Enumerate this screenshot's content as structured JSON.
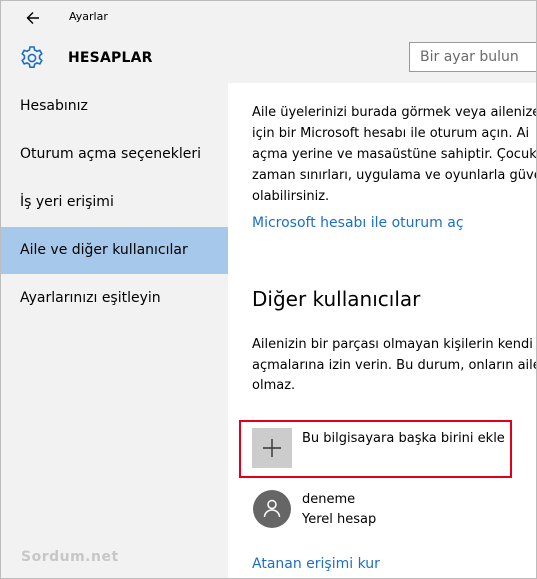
{
  "window": {
    "title": "Ayarlar",
    "back_icon": "arrow-left-icon"
  },
  "header": {
    "gear_icon": "gear-icon",
    "heading": "HESAPLAR",
    "search_placeholder": "Bir ayar bulun"
  },
  "sidebar": {
    "items": [
      {
        "label": "Hesabınız",
        "selected": false
      },
      {
        "label": "Oturum açma seçenekleri",
        "selected": false
      },
      {
        "label": "İş yeri erişimi",
        "selected": false
      },
      {
        "label": "Aile ve diğer kullanıcılar",
        "selected": true
      },
      {
        "label": "Ayarlarınızı eşitleyin",
        "selected": false
      }
    ],
    "watermark": "Sordum.net",
    "selected_color": "#a6c8ea"
  },
  "main": {
    "family_paragraph": [
      "Aile üyelerinizi burada görmek veya ailenize",
      "için bir Microsoft hesabı ile oturum açın. Ai",
      "açma yerine ve masaüstüne sahiptir. Çocukl",
      "zaman sınırları, uygulama ve oyunlarla güve",
      "olabilirsiniz."
    ],
    "signin_link": "Microsoft hesabı ile oturum aç",
    "other_users_title": "Diğer kullanıcılar",
    "other_users_paragraph": [
      "Ailenizin bir parçası olmayan kişilerin kendi",
      "açmalarına izin verin. Bu durum, onların aile",
      "olmaz."
    ],
    "add_user": {
      "icon": "plus-icon",
      "label": "Bu bilgisayara başka birini ekle",
      "highlight_color": "#e0001b"
    },
    "user": {
      "icon": "person-icon",
      "name": "deneme",
      "type": "Yerel hesap"
    },
    "assigned_access_link": "Atanan erişimi kur",
    "link_color": "#1b6fc7"
  }
}
